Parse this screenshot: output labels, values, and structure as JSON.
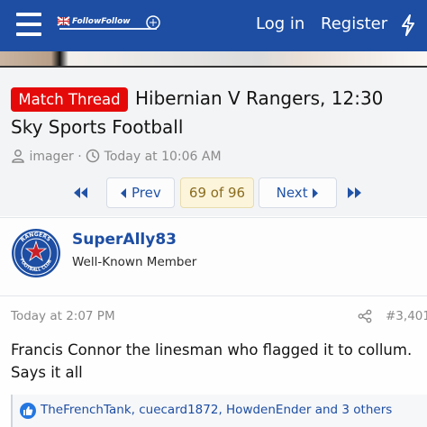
{
  "header": {
    "logo_text": "FollowFollow",
    "login_label": "Log in",
    "register_label": "Register",
    "accent_color": "#1d4ea3"
  },
  "thread": {
    "prefix_badge": "Match Thread",
    "prefix_color": "#e50a0a",
    "title_line1": "Hibernian V Rangers, 12:30",
    "title_line2": "Sky Sports Football",
    "author": "imager",
    "separator": "·",
    "started": "Today at 10:06 AM"
  },
  "pagination": {
    "prev_label": "Prev",
    "current": "69 of 96",
    "next_label": "Next"
  },
  "post": {
    "username": "SuperAlly83",
    "user_title": "Well-Known Member",
    "timestamp": "Today at 2:07 PM",
    "post_number": "#3,401",
    "text_line1": "Francis Connor the linesman who flagged it to collum.",
    "text_line2": "Says it all",
    "reactions": "TheFrenchTank, cuecard1872, HowdenEnder and 3 others",
    "avatar_text": "RANGERS FOOTBALL CLUB"
  },
  "icons": {
    "menu": "hamburger-icon",
    "search": "bolt-icon",
    "user": "user-icon",
    "clock": "clock-icon",
    "first_page": "double-chevron-left-icon",
    "last_page": "double-chevron-right-icon",
    "share": "share-icon",
    "like": "like-icon"
  }
}
